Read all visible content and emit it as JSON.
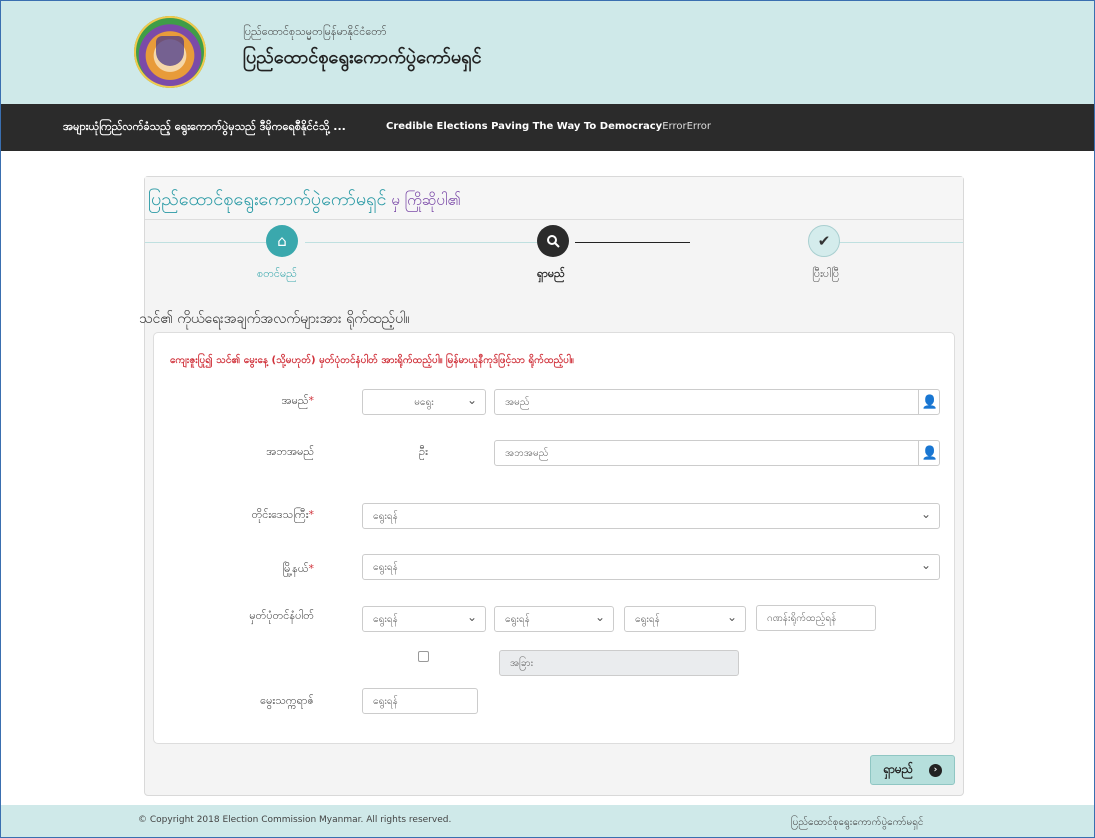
{
  "header": {
    "subtitle": "ပြည်ထောင်စုသမ္မတမြန်မာနိုင်ငံတော်",
    "title": "ပြည်ထောင်စုရွေးကောက်ပွဲကော်မရှင်"
  },
  "navbar": {
    "left_text": "အများယုံကြည်လက်ခံသည့် ရွေးကောက်ပွဲမှသည် ဒီမိုကရေစီနိုင်ငံသို့ ...",
    "right_text": "Credible Elections Paving The Way To Democracy",
    "error_text": "ErrorError"
  },
  "card": {
    "title": "ပြည်ထောင်စုရွေးကောက်ပွဲကော်မရှင်",
    "greeting": " မှ ကြိုဆိုပါ၏"
  },
  "steps": [
    {
      "label": "စတင်မည်",
      "icon": "home-icon",
      "state": "done"
    },
    {
      "label": "ရှာမည်",
      "icon": "search-icon",
      "state": "active"
    },
    {
      "label": "ပြီးပါပြီ",
      "icon": "check-icon",
      "state": "pending"
    }
  ],
  "intro": "သင်၏ ကိုယ်ရေးအချက်အလက်များအား ရိုက်ထည့်ပါ။",
  "form": {
    "warning": "ကျေးဇူးပြု၍ သင်၏ မွေးနေ့ (သို့မဟုတ်) မှတ်ပုံတင်နံပါတ် အားရိုက်ထည့်ပါ။ မြန်မာယူနီကုဒ်ဖြင့်သာ ရိုက်ထည့်ပါ။",
    "name_label": "အမည်",
    "name_prefix_value": "မရွေး",
    "name_placeholder": "အမည်",
    "father_label": "အဘအမည်",
    "father_prefix": "ဦး",
    "father_placeholder": "အဘအမည်",
    "region_label": "တိုင်းဒေသကြီး",
    "region_value": "ရွေးရန်",
    "township_label": "မြို့နယ်",
    "township_value": "ရွေးရန်",
    "nrc_label": "မှတ်ပုံတင်နံပါတ်",
    "nrc_state": "ရွေးရန်",
    "nrc_township": "ရွေးရန်",
    "nrc_type": "ရွေးရန်",
    "nrc_number_placeholder": "ဂဏန်းရိုက်ထည့်ရန်",
    "other_placeholder": "အခြား",
    "dob_label": "မွေးသက္ကရာဇ်",
    "dob_placeholder": "ရွေးရန်",
    "required_mark": "*"
  },
  "search_button": "ရှာမည်",
  "footer": {
    "copyright": "© Copyright 2018 Election Commission Myanmar. All rights reserved.",
    "right": "ပြည်ထောင်စုရွေးကောက်ပွဲကော်မရှင်"
  }
}
